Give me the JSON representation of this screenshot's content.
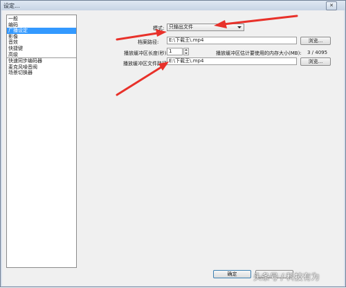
{
  "window": {
    "title": "设定..."
  },
  "sidebar": {
    "items": [
      {
        "label": "一般"
      },
      {
        "label": "编码"
      },
      {
        "label": "广播设定",
        "selected": true
      },
      {
        "label": "影像"
      },
      {
        "label": "音效"
      },
      {
        "label": "快捷键"
      },
      {
        "label": "高级"
      },
      {
        "label": "快速同步编码器"
      },
      {
        "label": "麦克风噪音阀"
      },
      {
        "label": "场景切换器"
      }
    ]
  },
  "broadcast": {
    "mode_label": "模式:",
    "mode_value": "只输出文件",
    "file_path_label": "档案路径:",
    "file_path_value": "E:\\下载王\\.mp4",
    "browse_label": "浏览...",
    "buffer_length_label": "播放缓冲区长度(秒):",
    "buffer_length_value": "1",
    "memory_label": "播放缓冲区估计要使用的内存大小(MB):",
    "memory_value": "3 / 4095",
    "buffer_file_label": "播放缓冲区文件路径:",
    "buffer_file_value": "E:\\下载王\\.mp4"
  },
  "footer": {
    "ok_label": "确定"
  },
  "watermark": {
    "text": "头条号 / 科技有为"
  },
  "colors": {
    "selection": "#3399ff",
    "annotation_arrow": "#e8312a"
  }
}
